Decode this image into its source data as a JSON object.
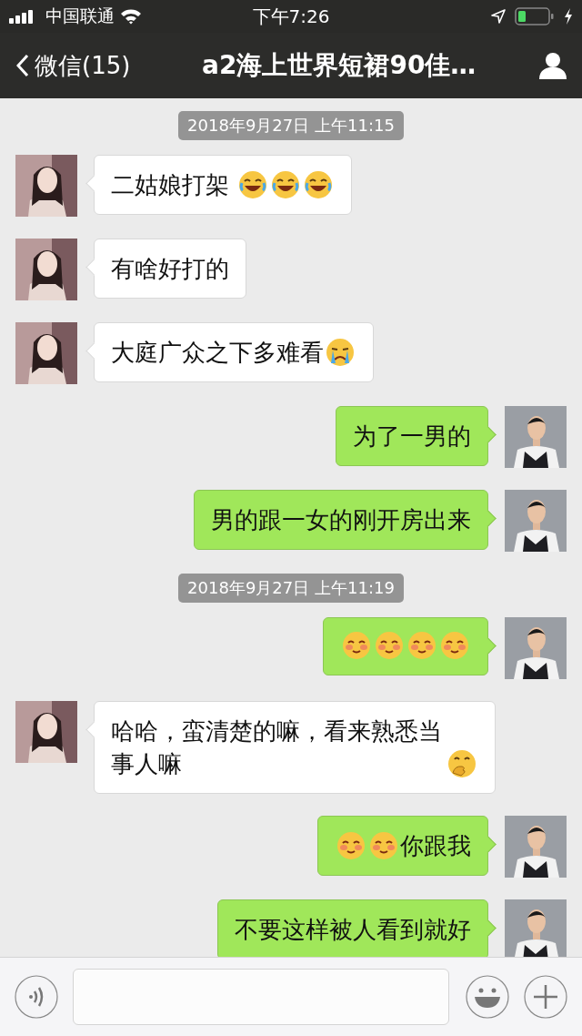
{
  "status_bar": {
    "carrier": "中国联通",
    "time": "下午7:26"
  },
  "nav_bar": {
    "back": "微信(15)",
    "title": "a2海上世界短裙90佳…"
  },
  "messages": [
    {
      "kind": "time",
      "text": "2018年9月27日 上午11:15"
    },
    {
      "kind": "incoming",
      "parts": [
        {
          "kind": "text",
          "text": "二姑娘打架 "
        },
        {
          "kind": "laugh"
        },
        {
          "kind": "laugh"
        },
        {
          "kind": "laugh"
        }
      ]
    },
    {
      "kind": "incoming",
      "parts": [
        {
          "kind": "text",
          "text": "有啥好打的"
        }
      ]
    },
    {
      "kind": "incoming",
      "parts": [
        {
          "kind": "text",
          "text": "大庭广众之下多难看"
        },
        {
          "kind": "cry"
        }
      ]
    },
    {
      "kind": "outgoing",
      "parts": [
        {
          "kind": "text",
          "text": "为了一男的"
        }
      ]
    },
    {
      "kind": "outgoing",
      "parts": [
        {
          "kind": "text",
          "text": "男的跟一女的刚开房出来"
        }
      ]
    },
    {
      "kind": "time",
      "text": "2018年9月27日 上午11:19"
    },
    {
      "kind": "outgoing",
      "parts": [
        {
          "kind": "shy"
        },
        {
          "kind": "shy"
        },
        {
          "kind": "shy"
        },
        {
          "kind": "shy"
        }
      ]
    },
    {
      "kind": "incoming",
      "parts": [
        {
          "kind": "text",
          "text": "哈哈，蛮清楚的嘛，看来熟悉当事人嘛"
        },
        {
          "kind": "giggle"
        }
      ]
    },
    {
      "kind": "outgoing",
      "parts": [
        {
          "kind": "shy"
        },
        {
          "kind": "shy"
        },
        {
          "kind": "text",
          "text": "你跟我"
        }
      ]
    },
    {
      "kind": "outgoing",
      "parts": [
        {
          "kind": "text",
          "text": "不要这样被人看到就好"
        }
      ]
    }
  ]
}
